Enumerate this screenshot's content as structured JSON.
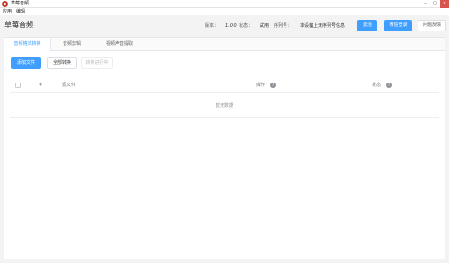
{
  "window": {
    "title": "草莓音频",
    "minimize": "–",
    "maximize": "□",
    "close": "×"
  },
  "menu": {
    "items": [
      "应用",
      "编辑"
    ]
  },
  "header": {
    "app_title": "草莓音频",
    "version_label": "版本：",
    "version": "1.0.0",
    "status_label": "状态：",
    "status": "试用",
    "serial_label": "序列号：",
    "serial": "本设备上无序列号信息",
    "activate_label": "激活",
    "wechat_login_label": "微信登录",
    "feedback_label": "问题反馈"
  },
  "tabs": [
    "音频格式转换",
    "音频剪辑",
    "视频声音提取"
  ],
  "toolbar": {
    "add_file": "添加文件",
    "convert_all": "全部转换",
    "converting": "转换进行中"
  },
  "table": {
    "columns": [
      "#",
      "源文件",
      "操作",
      "状态"
    ],
    "empty_text": "暂无数据"
  },
  "colors": {
    "accent": "#409eff",
    "close": "#d9534f"
  }
}
